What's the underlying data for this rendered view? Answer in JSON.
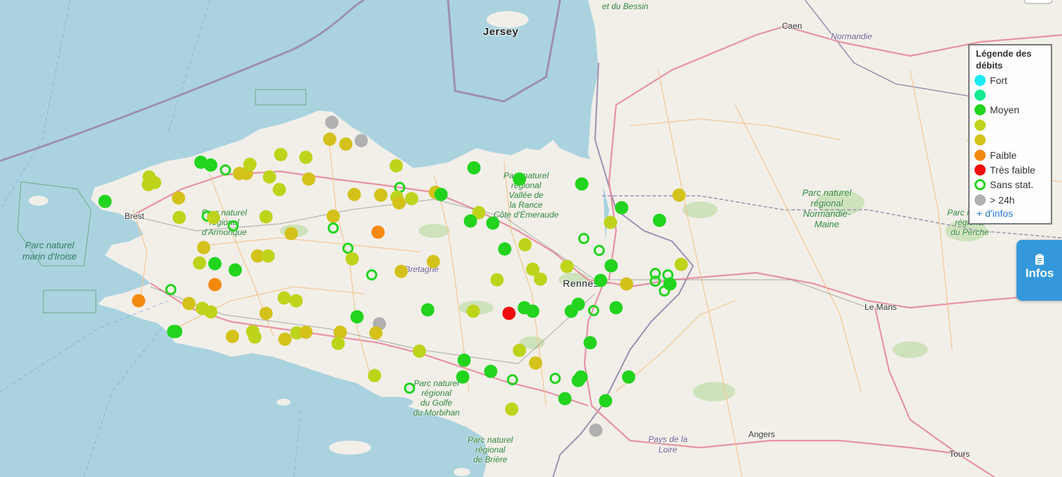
{
  "map": {
    "places": [
      {
        "name": "Jersey",
        "style": "big"
      },
      {
        "name": "Brest",
        "style": "town"
      },
      {
        "name": "Rennes",
        "style": "big"
      },
      {
        "name": "Caen",
        "style": "town"
      },
      {
        "name": "Le Mans",
        "style": "town"
      },
      {
        "name": "Angers",
        "style": "town"
      },
      {
        "name": "Tours",
        "style": "town"
      },
      {
        "name": "Normandie",
        "style": "region"
      },
      {
        "name": "Bretagne",
        "style": "region"
      },
      {
        "name": "Pays de la\nLoire",
        "style": "region"
      },
      {
        "name": "et du Bessin",
        "style": "park"
      }
    ],
    "parks": [
      {
        "name": "Parc naturel\nmarin d'Iroise",
        "kind": "sea"
      },
      {
        "name": "Parc naturel\nrégional\nd'Armorique",
        "kind": "land"
      },
      {
        "name": "Parc naturel\nrégional\nVallée de\nla Rance\nCôte d'Émeraude",
        "kind": "land"
      },
      {
        "name": "Parc naturel\nrégional\nNormandie-\nMaine",
        "kind": "land"
      },
      {
        "name": "Parc naturel\nrégional\ndu Perche",
        "kind": "land"
      },
      {
        "name": "Parc naturel\nrégional\ndu Golfe\ndu Morbihan",
        "kind": "land"
      },
      {
        "name": "Parc naturel\nrégional\nde Brière",
        "kind": "land"
      }
    ],
    "colors": {
      "sea": "#aad3df",
      "land": "#f2efe9",
      "border": "#9e8fb0",
      "motorway": "#e892a2",
      "road": "#f7c48b",
      "forest": "#c8e0b4",
      "park_outline": "#6aa882"
    }
  },
  "legend": {
    "title": "Légende des débits",
    "items": [
      {
        "label": "Fort",
        "color": "#1de9f5",
        "hollow": false
      },
      {
        "label": "",
        "color": "#14ea8e",
        "hollow": false
      },
      {
        "label": "Moyen",
        "color": "#22d41e",
        "hollow": false
      },
      {
        "label": "",
        "color": "#bed41b",
        "hollow": false
      },
      {
        "label": "",
        "color": "#d4c21b",
        "hollow": false
      },
      {
        "label": "Faible",
        "color": "#f5890e",
        "hollow": false
      },
      {
        "label": "Très faible",
        "color": "#ef0d0d",
        "hollow": false
      },
      {
        "label": "Sans stat.",
        "color": "#22d41e",
        "hollow": true
      },
      {
        "label": "> 24h",
        "color": "#b0b0b0",
        "hollow": false
      }
    ],
    "more_link": "+ d'infos"
  },
  "infos_button": {
    "label": "Infos",
    "icon": "clipboard-icon"
  },
  "stations": {
    "note_categories": [
      "Moyen-green",
      "yellow-green",
      "ochre",
      "Faible",
      "Très faible",
      "Sans stat.",
      "> 24h"
    ],
    "summary": {
      "Très faible": 1,
      "Faible": 3,
      "> 24h": 4
    }
  }
}
